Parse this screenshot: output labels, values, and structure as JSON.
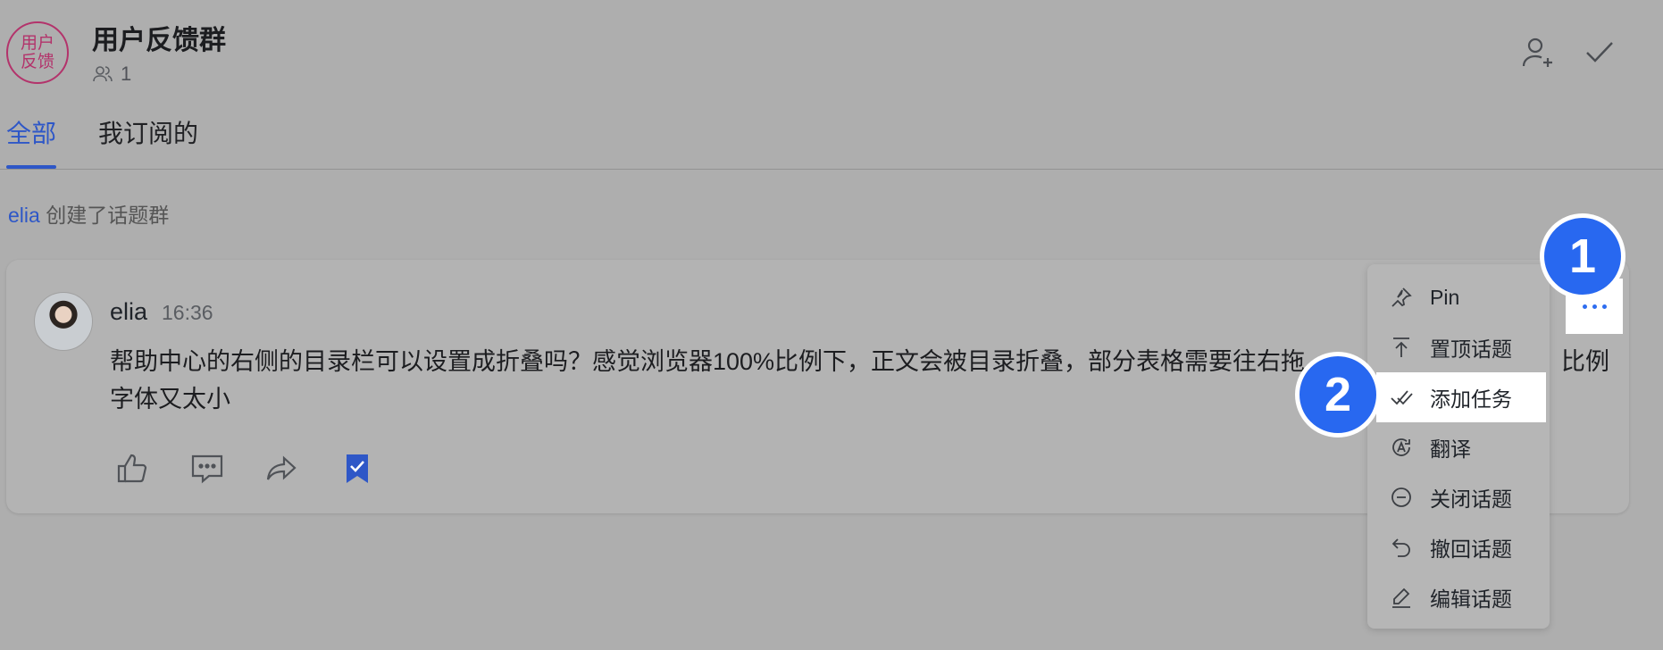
{
  "header": {
    "avatar_text_line1": "用户",
    "avatar_text_line2": "反馈",
    "title": "用户反馈群",
    "member_count": "1"
  },
  "tabs": [
    {
      "label": "全部",
      "active": true
    },
    {
      "label": "我订阅的",
      "active": false
    }
  ],
  "system_message": {
    "actor": "elia",
    "text": "创建了话题群"
  },
  "message": {
    "author": "elia",
    "time": "16:36",
    "text_line1": "帮助中心的右侧的目录栏可以设置成折叠吗？感觉浏览器100%比例下，正文会被目录折叠，部分表格需要往右拖",
    "text_line1_tail": "比例",
    "text_line2": "字体又太小"
  },
  "menu": {
    "items": [
      {
        "label": "Pin",
        "icon": "pin-icon"
      },
      {
        "label": "置顶话题",
        "icon": "top-icon"
      },
      {
        "label": "添加任务",
        "icon": "task-icon",
        "highlighted": true
      },
      {
        "label": "翻译",
        "icon": "translate-icon"
      },
      {
        "label": "关闭话题",
        "icon": "close-topic-icon"
      },
      {
        "label": "撤回话题",
        "icon": "undo-icon"
      },
      {
        "label": "编辑话题",
        "icon": "edit-icon"
      }
    ]
  },
  "badges": {
    "step1": "1",
    "step2": "2"
  },
  "colors": {
    "accent": "#2e57c7",
    "badge": "#2868f0",
    "overlay": "#aeaeae"
  }
}
